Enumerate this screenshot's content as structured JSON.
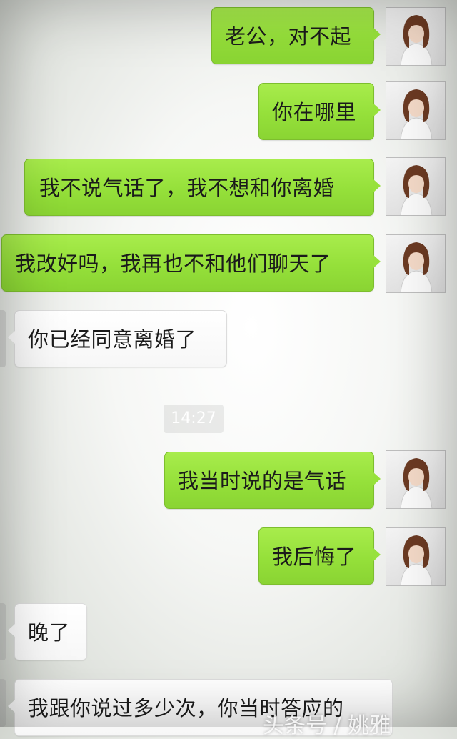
{
  "timestamp": "14:27",
  "messages": [
    {
      "side": "out",
      "text": "老公，对不起"
    },
    {
      "side": "out",
      "text": "你在哪里"
    },
    {
      "side": "out",
      "text": "我不说气话了，我不想和你离婚"
    },
    {
      "side": "out",
      "text": "我改好吗，我再也不和他们聊天了"
    },
    {
      "side": "in",
      "text": "你已经同意离婚了"
    },
    {
      "side": "out",
      "text": "我当时说的是气话"
    },
    {
      "side": "out",
      "text": "我后悔了"
    },
    {
      "side": "in",
      "text": "晚了"
    },
    {
      "side": "in",
      "text": "我跟你说过多少次，你当时答应的"
    }
  ],
  "watermark": "头条号 / 姚雅",
  "colors": {
    "outgoing_bubble": "#97e13b",
    "incoming_bubble": "#ffffff",
    "text": "#1b1b1b"
  },
  "avatar_icon": "user-avatar-girl"
}
